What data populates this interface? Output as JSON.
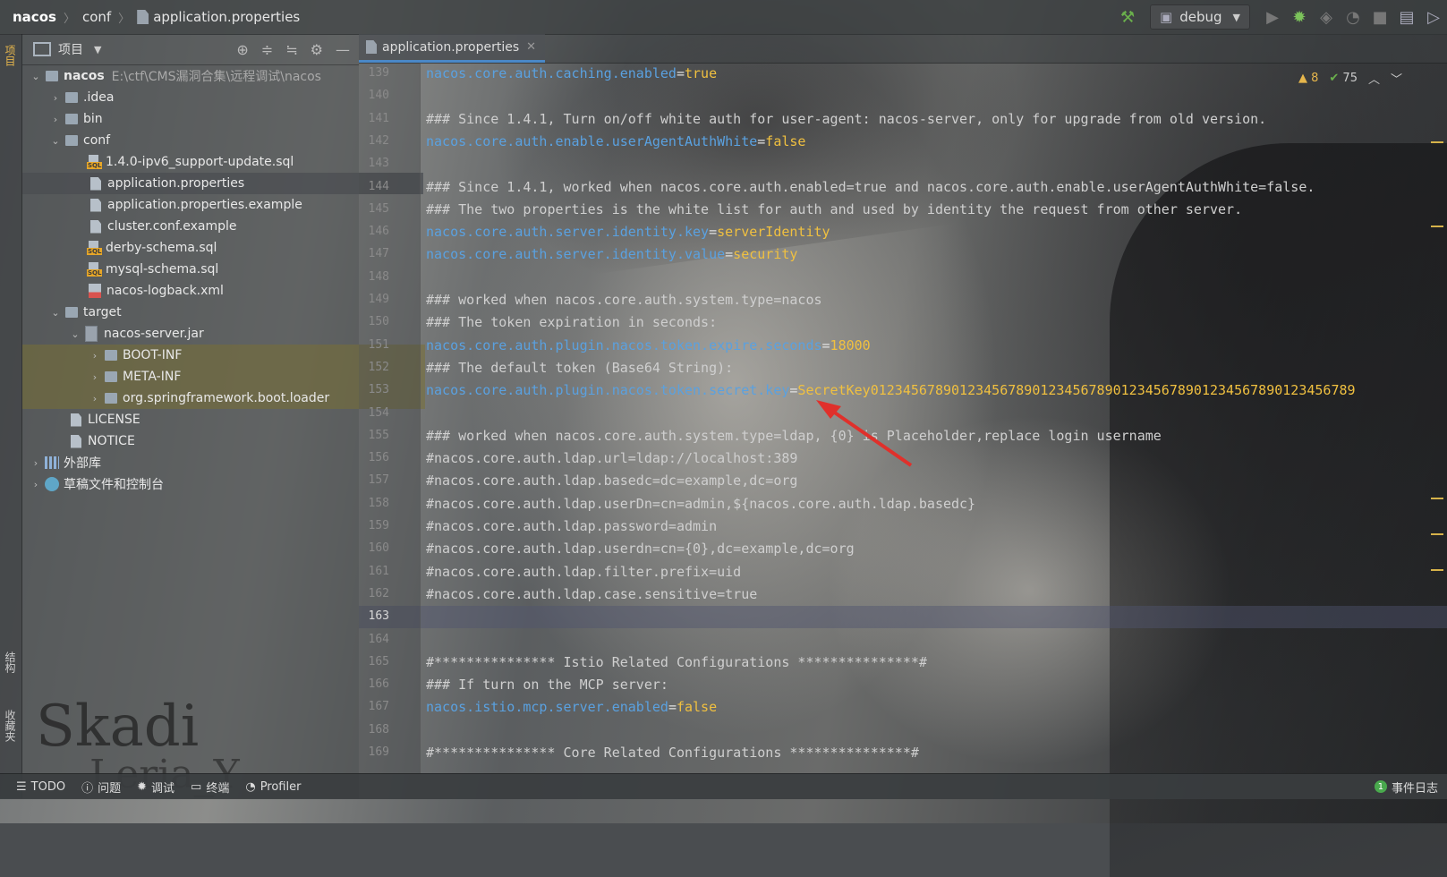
{
  "breadcrumb": {
    "root": "nacos",
    "folder": "conf",
    "file": "application.properties"
  },
  "toolbar": {
    "run_config": "debug"
  },
  "left_strip": {
    "project": "项目",
    "structure": "结构",
    "favorites": "收藏夹"
  },
  "project_panel": {
    "title": "项目",
    "tree": [
      {
        "label": "nacos",
        "extra": "E:\\ctf\\CMS漏洞合集\\远程调试\\nacos"
      },
      {
        "label": ".idea"
      },
      {
        "label": "bin"
      },
      {
        "label": "conf"
      },
      {
        "label": "1.4.0-ipv6_support-update.sql"
      },
      {
        "label": "application.properties"
      },
      {
        "label": "application.properties.example"
      },
      {
        "label": "cluster.conf.example"
      },
      {
        "label": "derby-schema.sql"
      },
      {
        "label": "mysql-schema.sql"
      },
      {
        "label": "nacos-logback.xml"
      },
      {
        "label": "target"
      },
      {
        "label": "nacos-server.jar"
      },
      {
        "label": "BOOT-INF"
      },
      {
        "label": "META-INF"
      },
      {
        "label": "org.springframework.boot.loader"
      },
      {
        "label": "LICENSE"
      },
      {
        "label": "NOTICE"
      },
      {
        "label": "外部库"
      },
      {
        "label": "草稿文件和控制台"
      }
    ]
  },
  "editor": {
    "tab_label": "application.properties",
    "inspections": {
      "warnings": "8",
      "ok": "75"
    },
    "lines": [
      {
        "n": "139",
        "key": "nacos.core.auth.caching.enabled",
        "val": "true"
      },
      {
        "n": "140"
      },
      {
        "n": "141",
        "comment": "### Since 1.4.1, Turn on/off white auth for user-agent: nacos-server, only for upgrade from old version."
      },
      {
        "n": "142",
        "key": "nacos.core.auth.enable.userAgentAuthWhite",
        "val": "false"
      },
      {
        "n": "143"
      },
      {
        "n": "144",
        "comment": "### Since 1.4.1, worked when nacos.core.auth.enabled=true and nacos.core.auth.enable.userAgentAuthWhite=false."
      },
      {
        "n": "145",
        "comment": "### The two properties is the white list for auth and used by identity the request from other server."
      },
      {
        "n": "146",
        "key": "nacos.core.auth.server.identity.key",
        "val": "serverIdentity"
      },
      {
        "n": "147",
        "key": "nacos.core.auth.server.identity.value",
        "val": "security"
      },
      {
        "n": "148"
      },
      {
        "n": "149",
        "comment": "### worked when nacos.core.auth.system.type=nacos"
      },
      {
        "n": "150",
        "comment": "### The token expiration in seconds:"
      },
      {
        "n": "151",
        "key": "nacos.core.auth.plugin.nacos.token.expire.seconds",
        "val": "18000"
      },
      {
        "n": "152",
        "comment": "### The default token (Base64 String):"
      },
      {
        "n": "153",
        "key": "nacos.core.auth.plugin.nacos.token.secret.key",
        "val": "SecretKey012345678901234567890123456789012345678901234567890123456789"
      },
      {
        "n": "154"
      },
      {
        "n": "155",
        "comment": "### worked when nacos.core.auth.system.type=ldap, {0} is Placeholder,replace login username"
      },
      {
        "n": "156",
        "comment": "#nacos.core.auth.ldap.url=ldap://localhost:389"
      },
      {
        "n": "157",
        "comment": "#nacos.core.auth.ldap.basedc=dc=example,dc=org"
      },
      {
        "n": "158",
        "comment": "#nacos.core.auth.ldap.userDn=cn=admin,${nacos.core.auth.ldap.basedc}"
      },
      {
        "n": "159",
        "comment": "#nacos.core.auth.ldap.password=admin"
      },
      {
        "n": "160",
        "comment": "#nacos.core.auth.ldap.userdn=cn={0},dc=example,dc=org"
      },
      {
        "n": "161",
        "comment": "#nacos.core.auth.ldap.filter.prefix=uid"
      },
      {
        "n": "162",
        "comment": "#nacos.core.auth.ldap.case.sensitive=true"
      },
      {
        "n": "163"
      },
      {
        "n": "164"
      },
      {
        "n": "165",
        "comment": "#*************** Istio Related Configurations ***************#"
      },
      {
        "n": "166",
        "comment": "### If turn on the MCP server:"
      },
      {
        "n": "167",
        "key": "nacos.istio.mcp.server.enabled",
        "val": "false"
      },
      {
        "n": "168"
      },
      {
        "n": "169",
        "comment": "#*************** Core Related Configurations ***************#"
      }
    ]
  },
  "statusbar": {
    "todo": "TODO",
    "problems": "问题",
    "debug": "调试",
    "terminal": "终端",
    "profiler": "Profiler",
    "event_count": "1",
    "event_log": "事件日志"
  },
  "watermark": {
    "line1": "Skadi",
    "line2": "Leria_Y"
  }
}
